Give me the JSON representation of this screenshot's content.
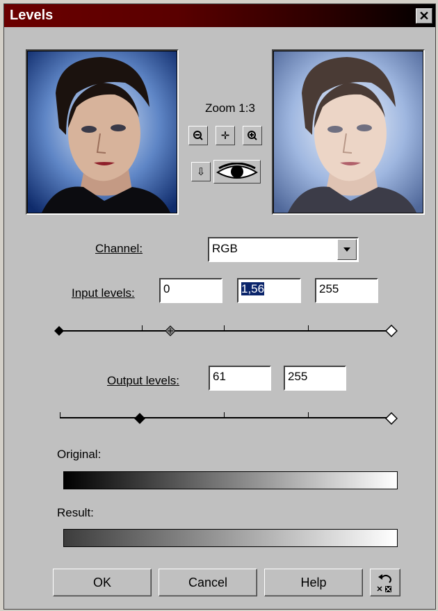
{
  "window": {
    "title": "Levels",
    "close_glyph": "✕"
  },
  "preview": {
    "zoom_label": "Zoom 1:3"
  },
  "toolbar": {
    "zoom_out_glyph": "−",
    "pan_glyph": "✛",
    "zoom_in_glyph": "+",
    "jump_glyph": "⇩"
  },
  "channel": {
    "label": "Channel:",
    "value": "RGB"
  },
  "input_levels": {
    "label": "Input levels:",
    "black": "0",
    "gamma": "1,56",
    "white": "255"
  },
  "output_levels": {
    "label": "Output levels:",
    "black": "61",
    "white": "255"
  },
  "gradients": {
    "original_label": "Original:",
    "result_label": "Result:"
  },
  "buttons": {
    "ok": "OK",
    "cancel": "Cancel",
    "help": "Help"
  },
  "colors": {
    "titlebar_start": "#6b0000",
    "dialog_bg": "#c0c0c0",
    "selection": "#0a246a"
  }
}
